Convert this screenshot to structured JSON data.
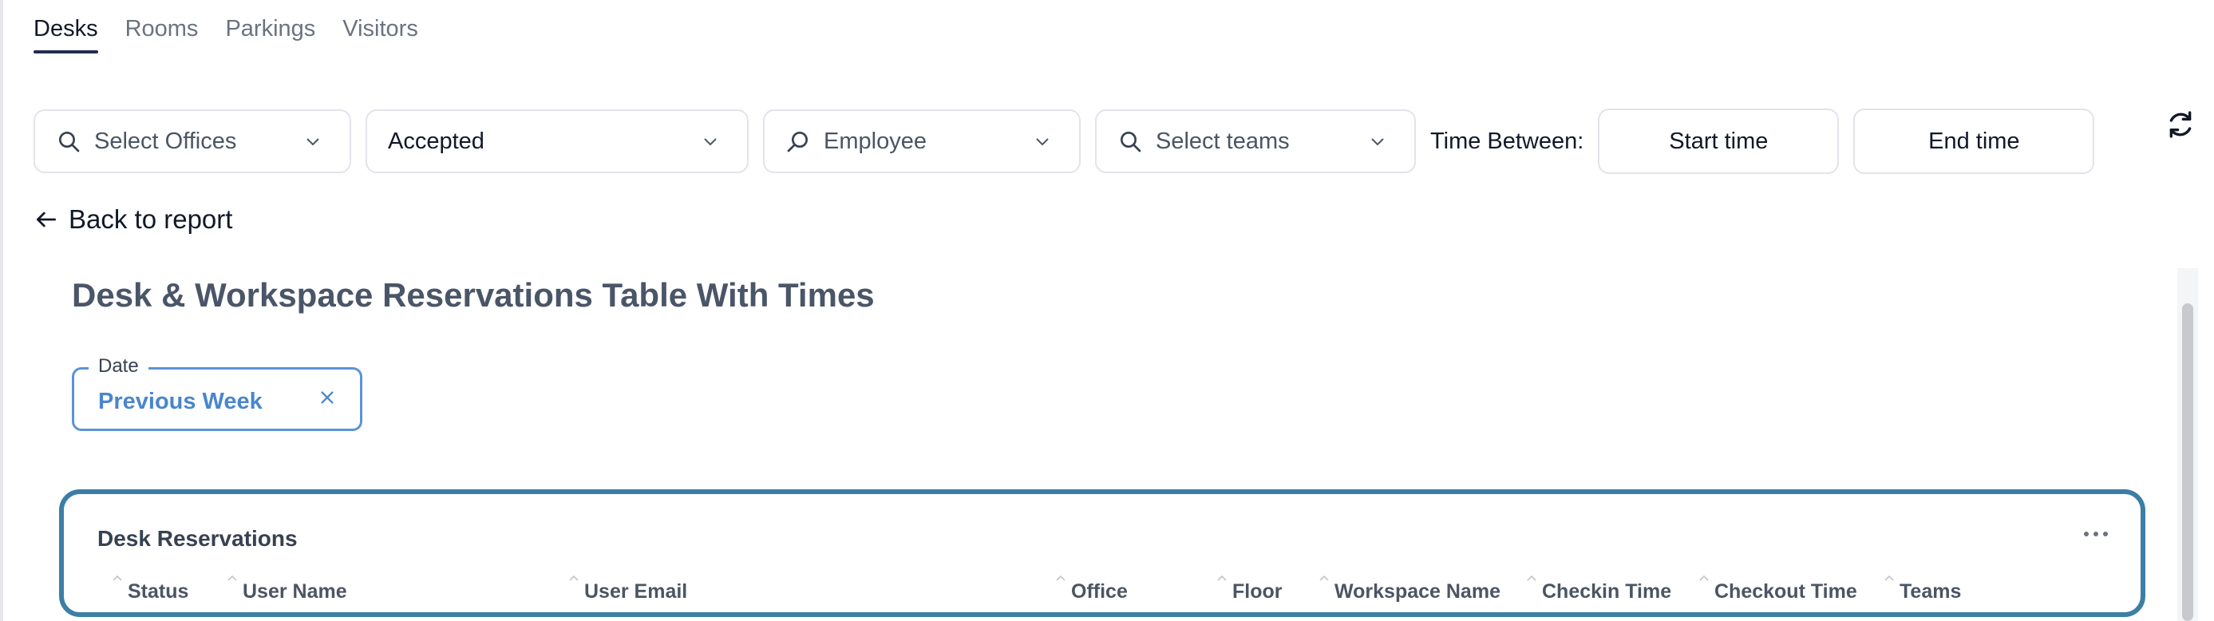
{
  "tabs": [
    {
      "label": "Desks",
      "active": true
    },
    {
      "label": "Rooms",
      "active": false
    },
    {
      "label": "Parkings",
      "active": false
    },
    {
      "label": "Visitors",
      "active": false
    }
  ],
  "filters": {
    "offices_placeholder": "Select Offices",
    "status_value": "Accepted",
    "employee_placeholder": "Employee",
    "teams_placeholder": "Select teams",
    "time_between_label": "Time Between:",
    "start_time_label": "Start time",
    "end_time_label": "End time"
  },
  "back_link": "Back to report",
  "report": {
    "title": "Desk & Workspace Reservations Table With Times",
    "date_filter": {
      "label": "Date",
      "value": "Previous Week"
    },
    "card": {
      "title": "Desk Reservations",
      "columns": [
        "Status",
        "User Name",
        "User Email",
        "Office",
        "Floor",
        "Workspace Name",
        "Checkin Time",
        "Checkout Time",
        "Teams"
      ]
    }
  },
  "colors": {
    "accent_blue": "#4a86cc",
    "card_border": "#3d7ea6",
    "tab_underline": "#1f2d4d"
  },
  "icons": [
    "search-icon",
    "chevron-down-icon",
    "refresh-icon",
    "arrow-left-icon",
    "close-icon",
    "more-horizontal-icon",
    "sort-caret-icon"
  ]
}
